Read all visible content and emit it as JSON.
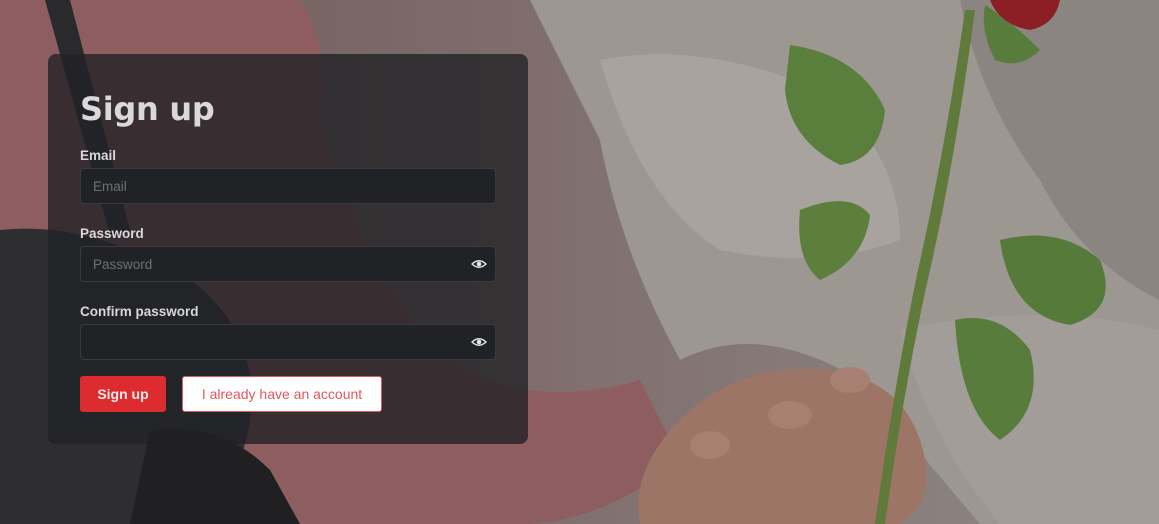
{
  "form": {
    "title": "Sign up",
    "email": {
      "label": "Email",
      "placeholder": "Email",
      "value": ""
    },
    "password": {
      "label": "Password",
      "placeholder": "Password",
      "value": ""
    },
    "confirm_password": {
      "label": "Confirm password",
      "placeholder": "",
      "value": ""
    },
    "submit_label": "Sign up",
    "login_label": "I already have an account"
  },
  "icons": {
    "password_toggle": "eye-icon",
    "confirm_toggle": "eye-icon"
  },
  "colors": {
    "accent": "#dd2c2f",
    "card_background": "#202125",
    "input_background": "#212226"
  }
}
